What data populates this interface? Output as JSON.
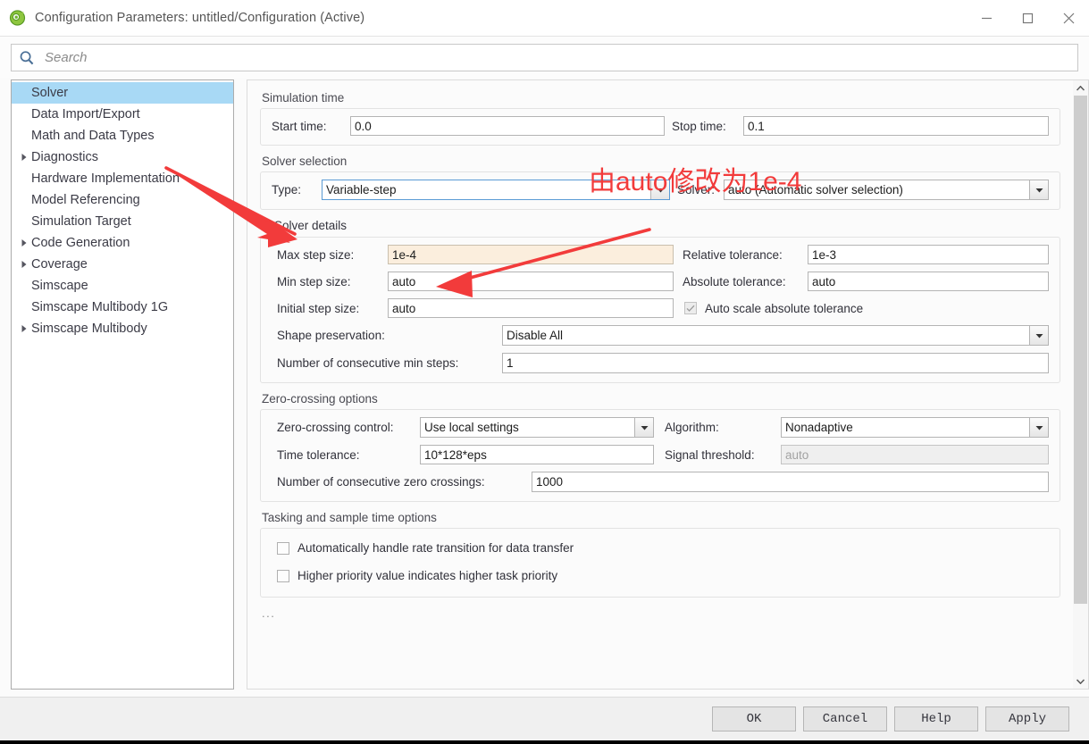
{
  "window": {
    "title": "Configuration Parameters: untitled/Configuration (Active)",
    "icon": "simulink-icon",
    "minimize_label": "—",
    "maximize_label": "□",
    "close_label": "✕"
  },
  "search": {
    "placeholder": "Search",
    "value": "",
    "icon": "search-icon"
  },
  "sidebar": {
    "items": [
      {
        "label": "Solver",
        "expandable": false,
        "selected": true
      },
      {
        "label": "Data Import/Export",
        "expandable": false,
        "selected": false
      },
      {
        "label": "Math and Data Types",
        "expandable": false,
        "selected": false
      },
      {
        "label": "Diagnostics",
        "expandable": true,
        "selected": false
      },
      {
        "label": "Hardware Implementation",
        "expandable": false,
        "selected": false
      },
      {
        "label": "Model Referencing",
        "expandable": false,
        "selected": false
      },
      {
        "label": "Simulation Target",
        "expandable": false,
        "selected": false
      },
      {
        "label": "Code Generation",
        "expandable": true,
        "selected": false
      },
      {
        "label": "Coverage",
        "expandable": true,
        "selected": false
      },
      {
        "label": "Simscape",
        "expandable": false,
        "selected": false
      },
      {
        "label": "Simscape Multibody 1G",
        "expandable": false,
        "selected": false
      },
      {
        "label": "Simscape Multibody",
        "expandable": true,
        "selected": false
      }
    ]
  },
  "main": {
    "simulation_time": {
      "group_label": "Simulation time",
      "start_time_label": "Start time:",
      "start_time_value": "0.0",
      "stop_time_label": "Stop time:",
      "stop_time_value": "0.1"
    },
    "solver_selection": {
      "group_label": "Solver selection",
      "type_label": "Type:",
      "type_value": "Variable-step",
      "solver_label": "Solver:",
      "solver_value": "auto (Automatic solver selection)"
    },
    "solver_details": {
      "disclosure_label": "Solver details",
      "expanded": true,
      "max_step_size_label": "Max step size:",
      "max_step_size_value": "1e-4",
      "max_step_size_modified": true,
      "relative_tolerance_label": "Relative tolerance:",
      "relative_tolerance_value": "1e-3",
      "min_step_size_label": "Min step size:",
      "min_step_size_value": "auto",
      "absolute_tolerance_label": "Absolute tolerance:",
      "absolute_tolerance_value": "auto",
      "initial_step_size_label": "Initial step size:",
      "initial_step_size_value": "auto",
      "auto_scale_label": "Auto scale absolute tolerance",
      "auto_scale_checked": true,
      "shape_preservation_label": "Shape preservation:",
      "shape_preservation_value": "Disable All",
      "consecutive_min_steps_label": "Number of consecutive min steps:",
      "consecutive_min_steps_value": "1"
    },
    "zero_crossing": {
      "group_label": "Zero-crossing options",
      "control_label": "Zero-crossing control:",
      "control_value": "Use local settings",
      "algorithm_label": "Algorithm:",
      "algorithm_value": "Nonadaptive",
      "time_tolerance_label": "Time tolerance:",
      "time_tolerance_value": "10*128*eps",
      "signal_threshold_label": "Signal threshold:",
      "signal_threshold_value": "auto",
      "signal_threshold_disabled": true,
      "consecutive_zc_label": "Number of consecutive zero crossings:",
      "consecutive_zc_value": "1000"
    },
    "tasking": {
      "group_label": "Tasking and sample time options",
      "auto_rate_transition_label": "Automatically handle rate transition for data transfer",
      "auto_rate_transition_checked": false,
      "higher_priority_label": "Higher priority value indicates higher task priority",
      "higher_priority_checked": false
    },
    "overflow_ellipsis": "..."
  },
  "buttons": {
    "ok": "OK",
    "cancel": "Cancel",
    "help": "Help",
    "apply": "Apply"
  },
  "annotations": {
    "note_text": "由auto修改为1e-4",
    "note_color": "#f23b3b",
    "arrow_count": 2
  },
  "colors": {
    "selection_blue": "#a8d9f5",
    "modified_field": "#fbeedd",
    "annotation_red": "#f23b3b",
    "focus_border": "#5b9bd5"
  }
}
